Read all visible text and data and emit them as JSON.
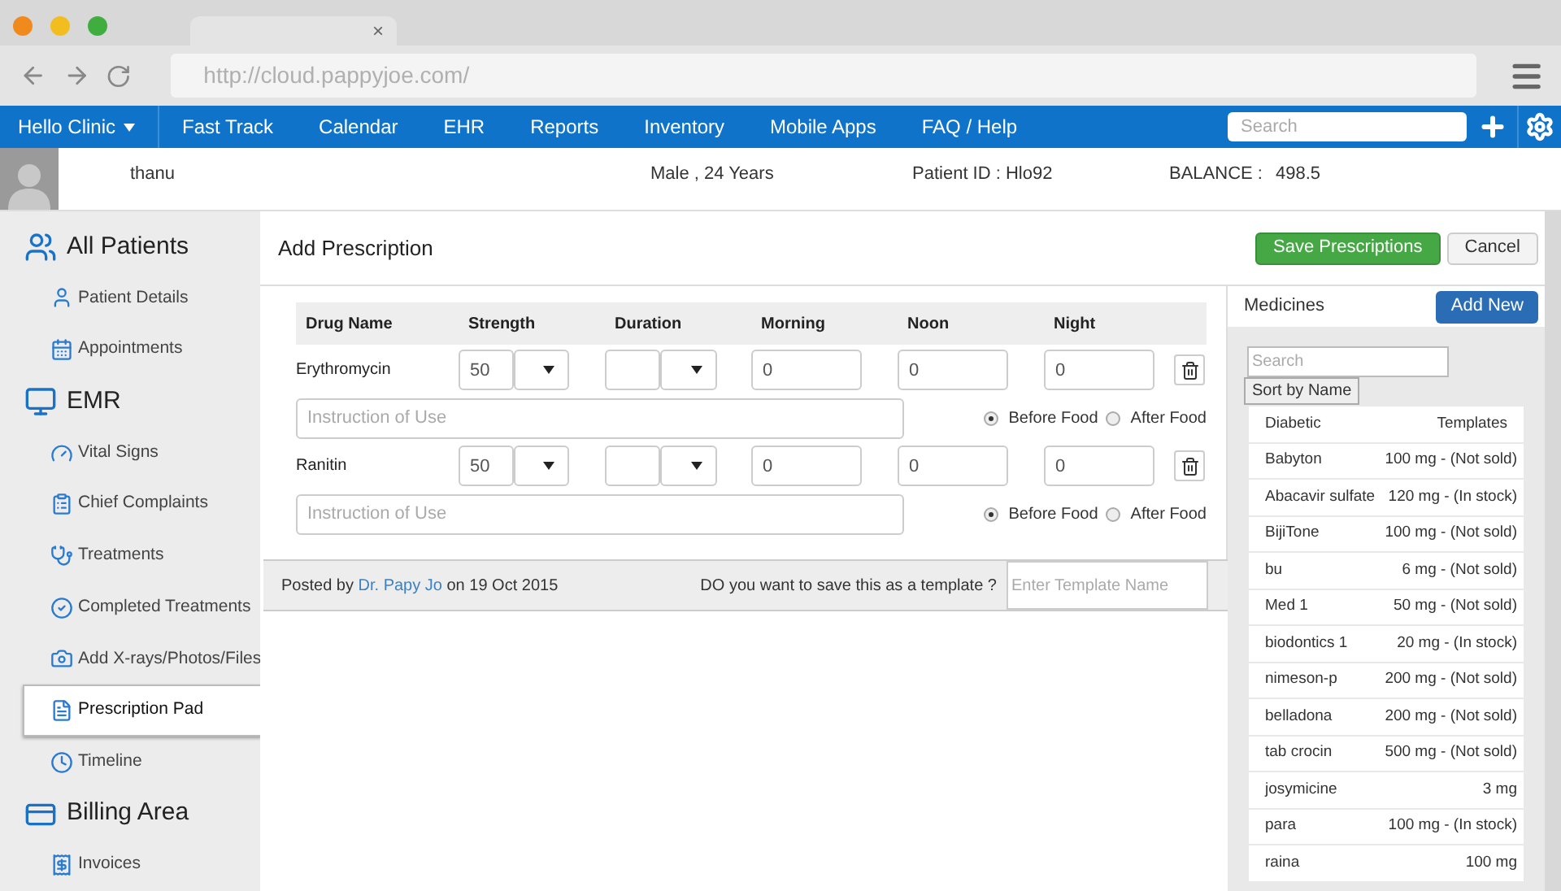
{
  "browser": {
    "tab_close": "×",
    "url": "http://cloud.pappyjoe.com/"
  },
  "nav": {
    "clinic": "Hello Clinic",
    "items": [
      "Fast Track",
      "Calendar",
      "EHR",
      "Reports",
      "Inventory",
      "Mobile Apps",
      "FAQ / Help"
    ],
    "search_placeholder": "Search"
  },
  "patient": {
    "name": "thanu",
    "gender_age": "Male , 24 Years",
    "patient_id": "Patient ID : Hlo92",
    "balance_label": "BALANCE :",
    "balance": "498.5"
  },
  "sidebar": {
    "items": [
      {
        "kind": "section",
        "label": "All Patients"
      },
      {
        "kind": "item",
        "label": "Patient Details",
        "selected": false
      },
      {
        "kind": "item",
        "label": "Appointments",
        "selected": false
      },
      {
        "kind": "section",
        "label": "EMR"
      },
      {
        "kind": "item",
        "label": "Vital Signs",
        "selected": false
      },
      {
        "kind": "item",
        "label": "Chief Complaints",
        "selected": false
      },
      {
        "kind": "item",
        "label": "Treatments",
        "selected": false
      },
      {
        "kind": "item",
        "label": "Completed Treatments",
        "selected": false
      },
      {
        "kind": "item",
        "label": "Add X-rays/Photos/Files",
        "selected": false
      },
      {
        "kind": "item",
        "label": "Prescription Pad",
        "selected": true
      },
      {
        "kind": "item",
        "label": "Timeline",
        "selected": false
      },
      {
        "kind": "section",
        "label": "Billing Area"
      },
      {
        "kind": "item",
        "label": "Invoices",
        "selected": false
      }
    ]
  },
  "form": {
    "title": "Add Prescription",
    "save_button": "Save Prescriptions",
    "cancel_button": "Cancel",
    "columns": [
      "Drug Name",
      "Strength",
      "Duration",
      "Morning",
      "Noon",
      "Night"
    ],
    "rows": [
      {
        "drug": "Erythromycin",
        "strength": "50",
        "morning": "0",
        "noon": "0",
        "night": "0",
        "instruction_placeholder": "Instruction of Use",
        "food": [
          {
            "label": "Before Food",
            "selected": true
          },
          {
            "label": "After Food",
            "selected": false
          }
        ]
      },
      {
        "drug": "Ranitin",
        "strength": "50",
        "morning": "0",
        "noon": "0",
        "night": "0",
        "instruction_placeholder": "Instruction of Use",
        "food": [
          {
            "label": "Before Food",
            "selected": true
          },
          {
            "label": "After Food",
            "selected": false
          }
        ]
      }
    ],
    "footer": {
      "posted_by": "Posted by",
      "author": "Dr. Papy Jo",
      "posted_on": "on 19 Oct 2015",
      "template_question": "DO you want to save this as a template ?",
      "template_placeholder": "Enter Template Name"
    }
  },
  "medicines": {
    "title": "Medicines",
    "add_button": "Add New",
    "search_placeholder": "Search",
    "sort_button": "Sort by Name",
    "header": {
      "left": "Diabetic",
      "right": "Templates"
    },
    "items": [
      {
        "name": "Babyton",
        "detail": "100 mg - (Not sold)"
      },
      {
        "name": "Abacavir sulfate",
        "detail": "120 mg - (In stock)"
      },
      {
        "name": "BijiTone",
        "detail": "100 mg - (Not sold)"
      },
      {
        "name": "bu",
        "detail": "6 mg - (Not sold)"
      },
      {
        "name": "Med 1",
        "detail": "50 mg - (Not sold)"
      },
      {
        "name": "biodontics 1",
        "detail": "20 mg - (In stock)"
      },
      {
        "name": "nimeson-p",
        "detail": "200 mg - (Not sold)"
      },
      {
        "name": "belladona",
        "detail": "200 mg - (Not sold)"
      },
      {
        "name": "tab crocin",
        "detail": "500 mg - (Not sold)"
      },
      {
        "name": "josymicine",
        "detail": "3 mg"
      },
      {
        "name": "para",
        "detail": "100 mg - (In stock)"
      },
      {
        "name": "raina",
        "detail": "100 mg"
      }
    ]
  }
}
